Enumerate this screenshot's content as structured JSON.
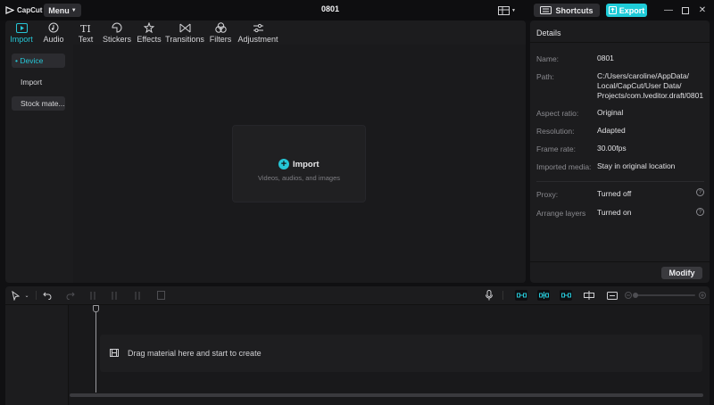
{
  "app": {
    "logo_text": "CapCut",
    "menu_label": "Menu",
    "project_title": "0801",
    "shortcuts_label": "Shortcuts",
    "export_label": "Export",
    "accent_color": "#1ecbd8"
  },
  "tabs": [
    {
      "label": "Import",
      "icon": "import-icon",
      "active": true
    },
    {
      "label": "Audio",
      "icon": "audio-icon"
    },
    {
      "label": "Text",
      "icon": "text-icon"
    },
    {
      "label": "Stickers",
      "icon": "sticker-icon"
    },
    {
      "label": "Effects",
      "icon": "effects-icon"
    },
    {
      "label": "Transitions",
      "icon": "transitions-icon"
    },
    {
      "label": "Filters",
      "icon": "filters-icon"
    },
    {
      "label": "Adjustment",
      "icon": "adjustment-icon"
    }
  ],
  "left_nav": {
    "items": [
      "• Device",
      "Import",
      "Stock mate..."
    ]
  },
  "import_area": {
    "button_label": "Import",
    "hint": "Videos, audios, and images"
  },
  "details": {
    "title": "Details",
    "rows": [
      {
        "label": "Name:",
        "value": "0801"
      },
      {
        "label": "Path:",
        "value_lines": [
          "C:/Users/caroline/AppData/",
          "Local/CapCut/User Data/",
          "Projects/com.lveditor.draft/0801"
        ]
      },
      {
        "label": "Aspect ratio:",
        "value": "Original"
      },
      {
        "label": "Resolution:",
        "value": "Adapted"
      },
      {
        "label": "Frame rate:",
        "value": "30.00fps"
      },
      {
        "label": "Imported media:",
        "value": "Stay in original location"
      },
      {
        "label": "Proxy:",
        "value": "Turned off"
      },
      {
        "label": "Arrange layers",
        "value": "Turned on"
      }
    ],
    "modify_label": "Modify"
  },
  "timeline": {
    "drop_text": "Drag material here and start to create"
  }
}
